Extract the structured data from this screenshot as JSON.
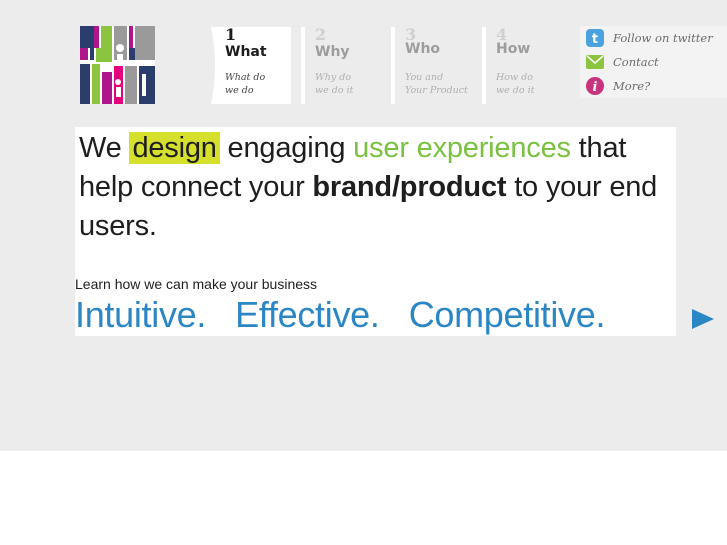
{
  "nav": {
    "tabs": [
      {
        "num": "1",
        "title": "What",
        "sub": "What do\nwe do",
        "active": true
      },
      {
        "num": "2",
        "title": "Why",
        "sub": "Why do\nwe do it",
        "active": false
      },
      {
        "num": "3",
        "title": "Who",
        "sub": "You and\nYour Product",
        "active": false
      },
      {
        "num": "4",
        "title": "How",
        "sub": "How do\nwe do it",
        "active": false
      }
    ]
  },
  "social": {
    "twitter_label": "Follow on twitter",
    "contact_label": "Contact",
    "more_label": "More?",
    "icons": [
      "twitter-icon",
      "mail-icon",
      "info-icon"
    ]
  },
  "headline": {
    "p1": "We ",
    "design": "design",
    "p2": " engaging ",
    "ux": "user experiences",
    "p3": " that help connect your ",
    "brand": "brand/product",
    "p4": " to your end users."
  },
  "learn": "Learn how we can make your business",
  "tagline": "Intuitive.   Effective.   Competitive.",
  "colors": {
    "background": "#ececec",
    "highlight": "#d4e02c",
    "green": "#7ac142",
    "blue": "#2b86c5",
    "logo_purple": "#b0168c",
    "logo_gray": "#9a9a9a",
    "logo_navy": "#2b3d6c",
    "logo_green": "#8bc53f",
    "logo_pink": "#e4007c"
  }
}
